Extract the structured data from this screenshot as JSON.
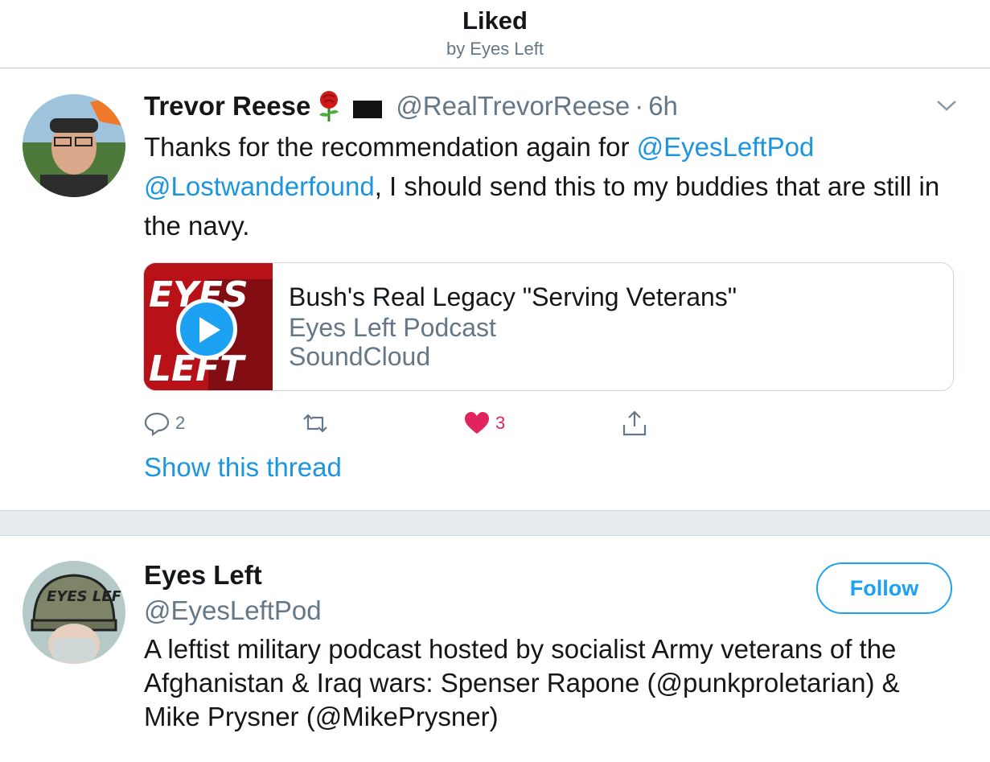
{
  "header": {
    "title": "Liked",
    "subtitle": "by Eyes Left"
  },
  "tweet": {
    "author_name": "Trevor Reese",
    "author_emojis": [
      "rose-icon",
      "black-flag-icon"
    ],
    "handle": "@RealTrevorReese",
    "separator": "·",
    "time": "6h",
    "text_parts": {
      "p1": "Thanks for the recommendation again for ",
      "mention1": "@EyesLeftPod",
      "mention2": "@Lostwanderfound",
      "p2": ", I should send this to my buddies that are still in the navy."
    },
    "card": {
      "title": "Bush's Real Legacy \"Serving Veterans\"",
      "subtitle": "Eyes Left Podcast",
      "domain": "SoundCloud",
      "thumb_text_top": "EYES",
      "thumb_text_bottom": "LEFT"
    },
    "actions": {
      "reply_count": "2",
      "retweet_count": "",
      "like_count": "3",
      "like_color": "#e0245e"
    },
    "show_thread": "Show this thread"
  },
  "user": {
    "name": "Eyes Left",
    "handle": "@EyesLeftPod",
    "follow_label": "Follow",
    "avatar_text": "EYES LEFT",
    "bio": "A leftist military podcast hosted by socialist Army veterans of the Afghanistan & Iraq wars: Spenser Rapone (@punkproletarian) & Mike Prysner (@MikePrysner)"
  },
  "colors": {
    "accent": "#1da1f2",
    "link": "#1b95e0",
    "secondary_text": "#657786",
    "separator_bg": "#e6ecf0"
  }
}
